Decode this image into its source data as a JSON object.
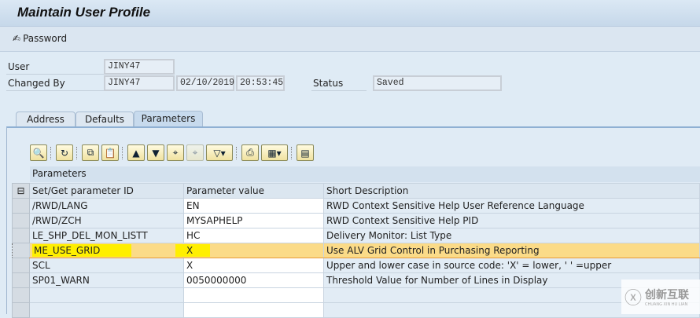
{
  "title": "Maintain User Profile",
  "toolbar": {
    "password_label": "Password"
  },
  "header": {
    "user_label": "User",
    "user_value": "JINY47",
    "changed_by_label": "Changed By",
    "changed_by_value": "JINY47",
    "date": "02/10/2019",
    "time": "20:53:45",
    "status_label": "Status",
    "status_value": "Saved"
  },
  "tabs": [
    {
      "label": "Address"
    },
    {
      "label": "Defaults"
    },
    {
      "label": "Parameters",
      "active": true
    }
  ],
  "grid": {
    "title": "Parameters",
    "columns": [
      "Set/Get parameter ID",
      "Parameter value",
      "Short Description"
    ],
    "rows": [
      [
        "/RWD/LANG",
        "EN",
        "RWD Context Sensitive Help User Reference Language"
      ],
      [
        "/RWD/ZCH",
        "MYSAPHELP",
        "RWD Context Sensitive Help PID"
      ],
      [
        "LE_SHP_DEL_MON_LISTT",
        "HC",
        "Delivery Monitor: List Type"
      ],
      [
        "ME_USE_GRID",
        "X",
        "Use ALV Grid Control in Purchasing Reporting"
      ],
      [
        "SCL",
        "X",
        "Upper and lower case in source code: 'X' = lower, ' ' =upper"
      ],
      [
        "SP01_WARN",
        "0050000000",
        "Threshold Value for Number of Lines in Display"
      ]
    ],
    "selected_row": 3
  },
  "watermark": {
    "text": "创新互联",
    "sub": "CHUANG XIN HU LIAN"
  },
  "colors": {
    "highlight": "#fbdb88",
    "marker": "#ffef00",
    "title_bg": "#c6d8ea"
  }
}
